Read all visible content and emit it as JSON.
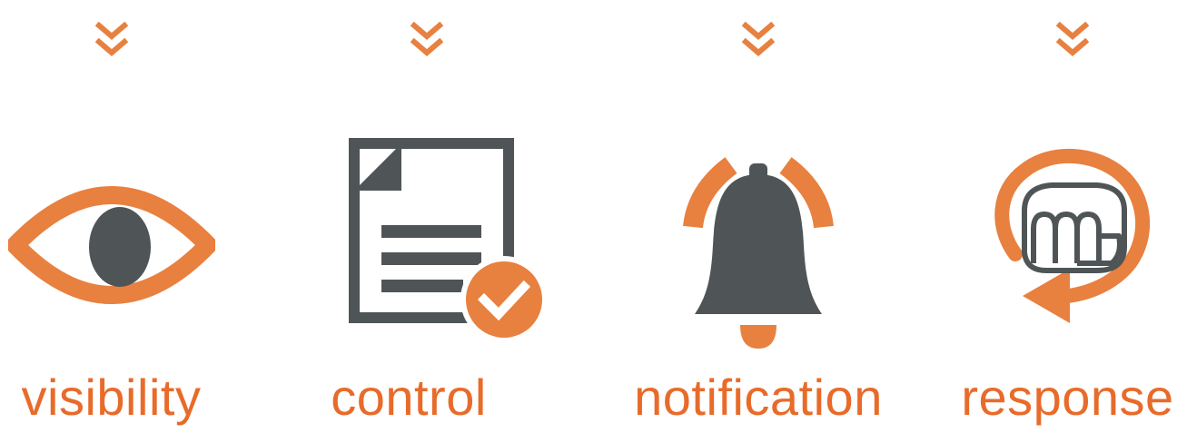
{
  "colors": {
    "accent": "#e8803f",
    "label": "#e86b2a",
    "dark": "#4f5556"
  },
  "steps": [
    {
      "label": "visibility",
      "icon": "eye-icon"
    },
    {
      "label": "control",
      "icon": "document-check-icon"
    },
    {
      "label": "notification",
      "icon": "bell-icon"
    },
    {
      "label": "response",
      "icon": "fist-rotate-icon"
    }
  ]
}
